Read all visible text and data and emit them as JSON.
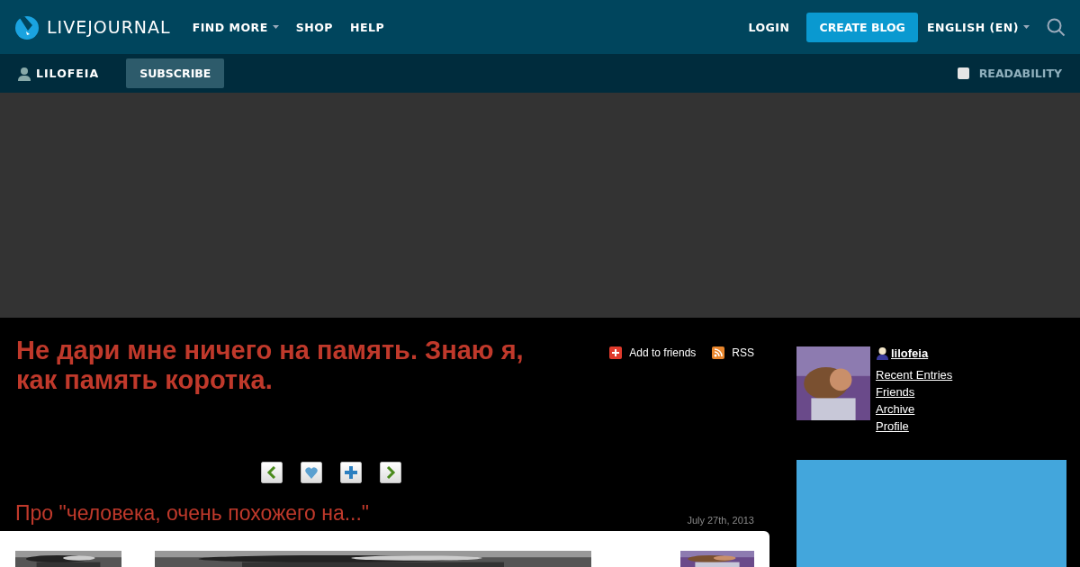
{
  "nav": {
    "logo": "LIVEJOURNAL",
    "links": [
      {
        "label": "FIND MORE",
        "dropdown": true
      },
      {
        "label": "SHOP",
        "dropdown": false
      },
      {
        "label": "HELP",
        "dropdown": false
      }
    ],
    "login": "LOGIN",
    "create": "CREATE BLOG",
    "language": "ENGLISH (EN)"
  },
  "subbar": {
    "user": "LILOFEIA",
    "subscribe": "SUBSCRIBE",
    "readability": {
      "label": "READABILITY",
      "checked": false
    }
  },
  "journal": {
    "title": "Не дари мне ничего на память. Знаю я, как память коротка.",
    "add_friends": "Add to friends",
    "rss": "RSS"
  },
  "entry_nav": [
    {
      "kind": "prev"
    },
    {
      "kind": "heart"
    },
    {
      "kind": "plus"
    },
    {
      "kind": "next"
    }
  ],
  "entry": {
    "title": "Про \"человека, очень похожего на...\"",
    "date": "July 27th, 2013"
  },
  "sidebar": {
    "user": "lilofeia",
    "links": [
      "Recent Entries",
      "Friends",
      "Archive",
      "Profile"
    ]
  }
}
